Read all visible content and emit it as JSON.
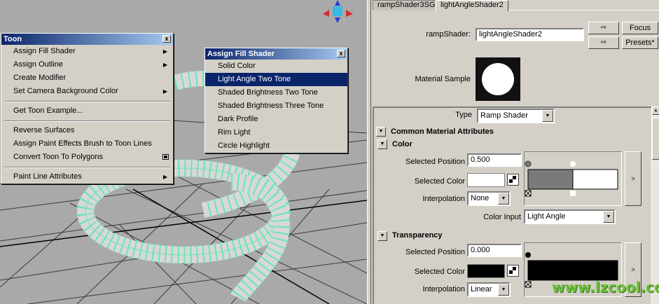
{
  "toon_menu": {
    "title": "Toon",
    "close": "x",
    "items": [
      {
        "label": "Assign Fill Shader",
        "submenu": true
      },
      {
        "label": "Assign Outline",
        "submenu": true
      },
      {
        "label": "Create Modifier"
      },
      {
        "label": "Set Camera Background Color",
        "submenu": true
      },
      {
        "label": "Get Toon Example..."
      },
      {
        "label": "Reverse Surfaces"
      },
      {
        "label": "Assign Paint Effects Brush to Toon Lines"
      },
      {
        "label": "Convert Toon To Polygons",
        "option_box": true
      },
      {
        "label": "Paint Line Attributes",
        "submenu": true
      }
    ]
  },
  "fill_menu": {
    "title": "Assign Fill Shader",
    "close": "x",
    "items": [
      "Solid Color",
      "Light Angle Two Tone",
      "Shaded Brightness Two Tone",
      "Shaded Brightness Three Tone",
      "Dark Profile",
      "Rim Light",
      "Circle Highlight"
    ],
    "highlighted": "Light Angle Two Tone"
  },
  "editor": {
    "tabs": [
      "rampShader3SG",
      "lightAngleShader2"
    ],
    "active_tab": "lightAngleShader2",
    "shader_label": "rampShader:",
    "shader_value": "lightAngleShader2",
    "focus_label": "Focus",
    "presets_label": "Presets*",
    "material_sample_label": "Material Sample",
    "type_label": "Type",
    "type_value": "Ramp Shader",
    "sections": {
      "common": "Common Material Attributes",
      "color": "Color",
      "transparency": "Transparency"
    },
    "color": {
      "pos_label": "Selected Position",
      "pos_value": "0.500",
      "color_label": "Selected Color",
      "interp_label": "Interpolation",
      "interp_value": "None",
      "input_label": "Color Input",
      "input_value": "Light Angle",
      "ramp_colors": [
        "#7a7a7a",
        "#ffffff"
      ],
      "ramp_split": 0.5
    },
    "transparency": {
      "pos_label": "Selected Position",
      "pos_value": "0.000",
      "color_label": "Selected Color",
      "interp_label": "Interpolation",
      "interp_value": "Linear",
      "ramp_colors": [
        "#000000"
      ]
    }
  },
  "watermark": "www.lzcool.com",
  "accent": "#0a246a",
  "wire_color": "#5ee8b0"
}
